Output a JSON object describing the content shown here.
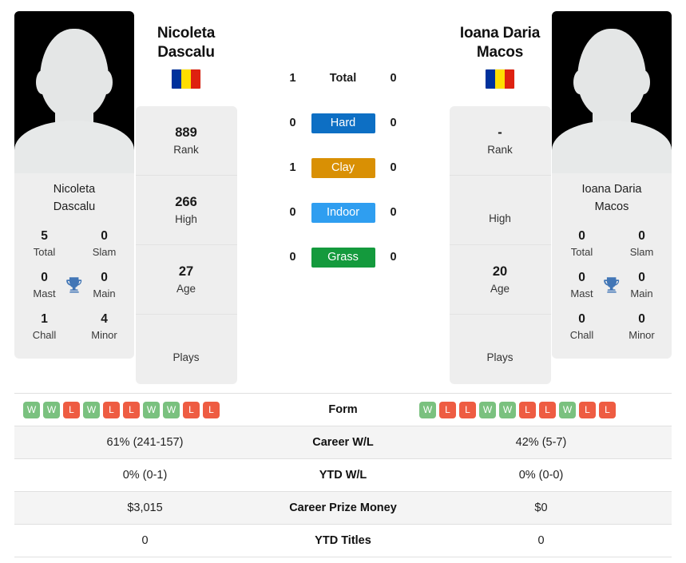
{
  "colors": {
    "hard": "#0d6fc4",
    "clay": "#d99004",
    "indoor": "#2f9ef0",
    "grass": "#149a3d",
    "win": "#7ac17f",
    "loss": "#ee5c42",
    "flag_blue": "#00319c",
    "flag_yellow": "#ffde00",
    "flag_red": "#de2110",
    "trophy": "#4276b6"
  },
  "players": {
    "left": {
      "name": "Nicoleta Dascalu",
      "name_line1": "Nicoleta",
      "name_line2": "Dascalu",
      "photo_caption_line1": "Nicoleta",
      "photo_caption_line2": "Dascalu",
      "flag": "romania-flag",
      "titles": {
        "total_value": "5",
        "total_label": "Total",
        "slam_value": "0",
        "slam_label": "Slam",
        "mast_value": "0",
        "mast_label": "Mast",
        "main_value": "0",
        "main_label": "Main",
        "chall_value": "1",
        "chall_label": "Chall",
        "minor_value": "4",
        "minor_label": "Minor"
      },
      "ranking": [
        {
          "value": "889",
          "label": "Rank"
        },
        {
          "value": "266",
          "label": "High"
        },
        {
          "value": "27",
          "label": "Age"
        },
        {
          "value": "",
          "label": "Plays"
        }
      ],
      "form": [
        "W",
        "W",
        "L",
        "W",
        "L",
        "L",
        "W",
        "W",
        "L",
        "L"
      ],
      "career_wl": "61% (241-157)",
      "ytd_wl": "0% (0-1)",
      "career_prize_money": "$3,015",
      "ytd_titles": "0"
    },
    "right": {
      "name": "Ioana Daria Macos",
      "name_line1": "Ioana Daria",
      "name_line2": "Macos",
      "photo_caption_line1": "Ioana Daria",
      "photo_caption_line2": "Macos",
      "flag": "romania-flag",
      "titles": {
        "total_value": "0",
        "total_label": "Total",
        "slam_value": "0",
        "slam_label": "Slam",
        "mast_value": "0",
        "mast_label": "Mast",
        "main_value": "0",
        "main_label": "Main",
        "chall_value": "0",
        "chall_label": "Chall",
        "minor_value": "0",
        "minor_label": "Minor"
      },
      "ranking": [
        {
          "value": "-",
          "label": "Rank"
        },
        {
          "value": "",
          "label": "High"
        },
        {
          "value": "20",
          "label": "Age"
        },
        {
          "value": "",
          "label": "Plays"
        }
      ],
      "form": [
        "W",
        "L",
        "L",
        "W",
        "W",
        "L",
        "L",
        "W",
        "L",
        "L"
      ],
      "career_wl": "42% (5-7)",
      "ytd_wl": "0% (0-0)",
      "career_prize_money": "$0",
      "ytd_titles": "0"
    }
  },
  "head_to_head": [
    {
      "label": "Total",
      "type": "plain",
      "left": "1",
      "right": "0"
    },
    {
      "label": "Hard",
      "type": "surface",
      "left": "0",
      "right": "0",
      "color": "#0d6fc4"
    },
    {
      "label": "Clay",
      "type": "surface",
      "left": "1",
      "right": "0",
      "color": "#d99004"
    },
    {
      "label": "Indoor",
      "type": "surface",
      "left": "0",
      "right": "0",
      "color": "#2f9ef0"
    },
    {
      "label": "Grass",
      "type": "surface",
      "left": "0",
      "right": "0",
      "color": "#149a3d"
    }
  ],
  "comparison_rows": [
    {
      "label": "Form",
      "type": "form",
      "left": "",
      "right": ""
    },
    {
      "label": "Career W/L",
      "type": "text",
      "left": "61% (241-157)",
      "right": "42% (5-7)"
    },
    {
      "label": "YTD W/L",
      "type": "text",
      "left": "0% (0-1)",
      "right": "0% (0-0)"
    },
    {
      "label": "Career Prize Money",
      "type": "text",
      "left": "$3,015",
      "right": "$0"
    },
    {
      "label": "YTD Titles",
      "type": "text",
      "left": "0",
      "right": "0"
    }
  ]
}
